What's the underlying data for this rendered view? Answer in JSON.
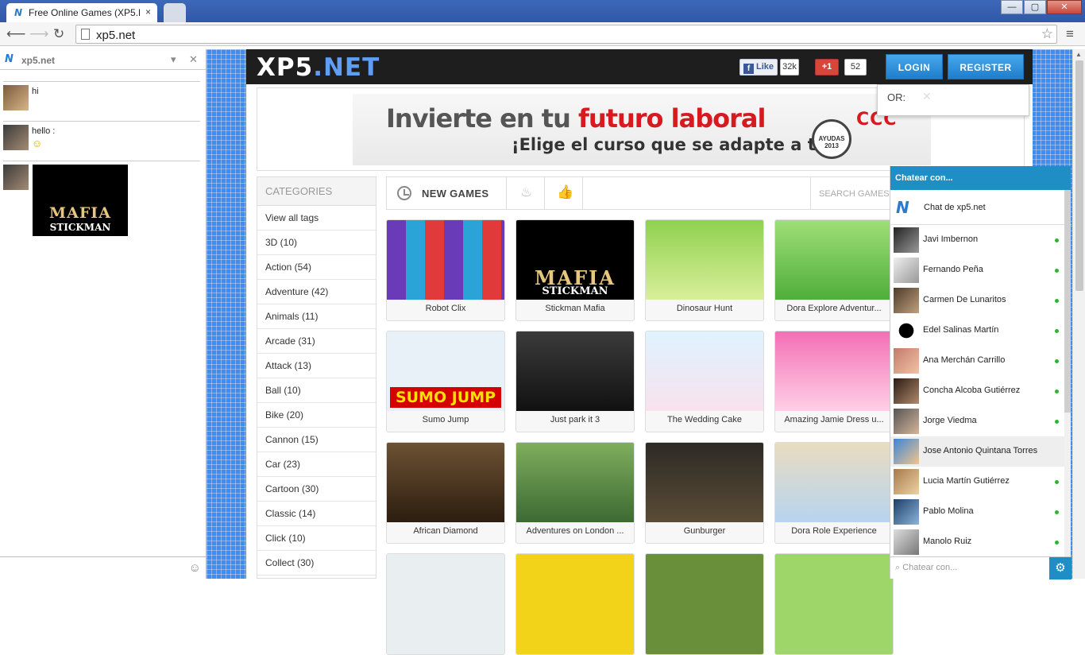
{
  "browser": {
    "tabs": [
      {
        "title": "Free Online Games (XP5.N",
        "close": "×"
      }
    ],
    "url": "xp5.net",
    "win_buttons": [
      "—",
      "▢",
      "✕"
    ]
  },
  "left_chat": {
    "site_name": "xp5.net",
    "messages": [
      {
        "text": "hi"
      },
      {
        "text": "hello :"
      },
      {
        "text": ""
      }
    ],
    "image_title": "MAFIA",
    "image_subtitle": "STICKMAN"
  },
  "site": {
    "logo_main": "XP5",
    "logo_accent": ".NET",
    "fb_like": "Like",
    "fb_count": "32k",
    "gplus": "+1",
    "gplus_count": "52",
    "login": "LOGIN",
    "register": "REGISTER",
    "or_label": "OR:",
    "ad": {
      "line1_a": "Invierte en tu ",
      "line1_b": "futuro laboral",
      "line2": "¡Elige el curso que se adapte a ti!",
      "seal": "AYUDAS 2013",
      "brand": "CCC"
    },
    "categories_header": "CATEGORIES",
    "categories": [
      "View all tags",
      "3D (10)",
      "Action (54)",
      "Adventure (42)",
      "Animals (11)",
      "Arcade (31)",
      "Attack (13)",
      "Ball (10)",
      "Bike (20)",
      "Cannon (15)",
      "Car (23)",
      "Cartoon (30)",
      "Classic (14)",
      "Click (10)",
      "Collect (30)"
    ],
    "new_games": "NEW GAMES",
    "search_placeholder": "SEARCH GAMES...",
    "games": [
      "Robot Clix",
      "Stickman Mafia",
      "Dinosaur Hunt",
      "Dora Explore Adventur...",
      "Sumo Jump",
      "Just park it 3",
      "The Wedding Cake",
      "Amazing Jamie Dress u...",
      "African Diamond",
      "Adventures on London ...",
      "Gunburger",
      "Dora Role Experience"
    ],
    "sumo_logo": "SUMO JUMP",
    "mafia_title": "MAFIA",
    "mafia_sub": "STICKMAN"
  },
  "right_chat": {
    "header": "Chatear con...",
    "site_chat": "Chat de xp5.net",
    "friends": [
      "Javi Imbernon",
      "Fernando Peña",
      "Carmen De Lunaritos",
      "Edel Salinas Martín",
      "Ana Merchán Carrillo",
      "Concha Alcoba Gutiérrez",
      "Jorge Viedma",
      "Jose Antonio Quintana Torres",
      "Lucia Martín Gutiérrez",
      "Pablo Molina",
      "Manolo Ruiz"
    ],
    "input_placeholder": "Chatear con..."
  }
}
